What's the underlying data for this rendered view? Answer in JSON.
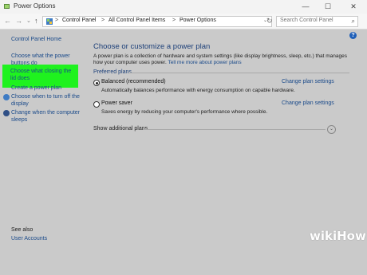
{
  "window": {
    "title": "Power Options"
  },
  "window_controls": {
    "minimize": "—",
    "maximize": "☐",
    "close": "✕"
  },
  "address": {
    "crumbs": [
      "Control Panel",
      "All Control Panel Items",
      "Power Options"
    ],
    "separator": ">",
    "search_placeholder": "Search Control Panel"
  },
  "sidebar": {
    "home": "Control Panel Home",
    "items": [
      {
        "label": "Choose what the power buttons do"
      },
      {
        "label": "Choose what closing the lid does"
      },
      {
        "label": "Create a power plan"
      },
      {
        "label": "Choose when to turn off the display"
      },
      {
        "label": "Change when the computer sleeps"
      }
    ],
    "see_also": "See also",
    "user_accounts": "User Accounts"
  },
  "main": {
    "heading": "Choose or customize a power plan",
    "description": "A power plan is a collection of hardware and system settings (like display brightness, sleep, etc.) that manages how your computer uses power.",
    "description_link": "Tell me more about power plans",
    "preferred_plans_label": "Preferred plans",
    "plans": [
      {
        "name": "Balanced (recommended)",
        "desc": "Automatically balances performance with energy consumption on capable hardware.",
        "change": "Change plan settings",
        "selected": true
      },
      {
        "name": "Power saver",
        "desc": "Saves energy by reducing your computer's performance where possible.",
        "change": "Change plan settings",
        "selected": false
      }
    ],
    "show_additional": "Show additional plans"
  },
  "watermark": {
    "wiki": "wiki",
    "how": "How"
  }
}
